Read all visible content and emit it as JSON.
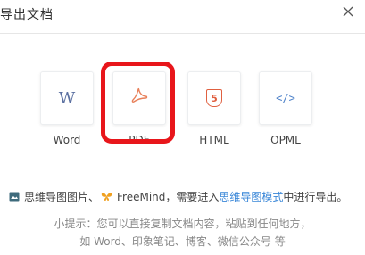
{
  "dialog": {
    "title": "导出文档",
    "close_label": "×"
  },
  "options": [
    {
      "label": "Word",
      "icon_text": "W",
      "icon_color": "#5a6fa0"
    },
    {
      "label": "PDF",
      "icon": "pdf-icon",
      "icon_color": "#e8805a"
    },
    {
      "label": "HTML",
      "icon_text": "5",
      "icon_color": "#e06040"
    },
    {
      "label": "OPML",
      "icon_text": "</>",
      "icon_color": "#4a7fc8"
    }
  ],
  "mindmap": {
    "part1": "思维导图图片、",
    "part2": "FreeMind",
    "part3": "，需要进入",
    "link": "思维导图模式",
    "part4": "中进行导出。"
  },
  "tip": {
    "line1": "小提示：您可以直接复制文档内容，粘贴到任何地方，",
    "line2": "如 Word、印象笔记、博客、微信公众号 等"
  },
  "colors": {
    "highlight": "#e8161b",
    "link": "#3a87d8"
  }
}
